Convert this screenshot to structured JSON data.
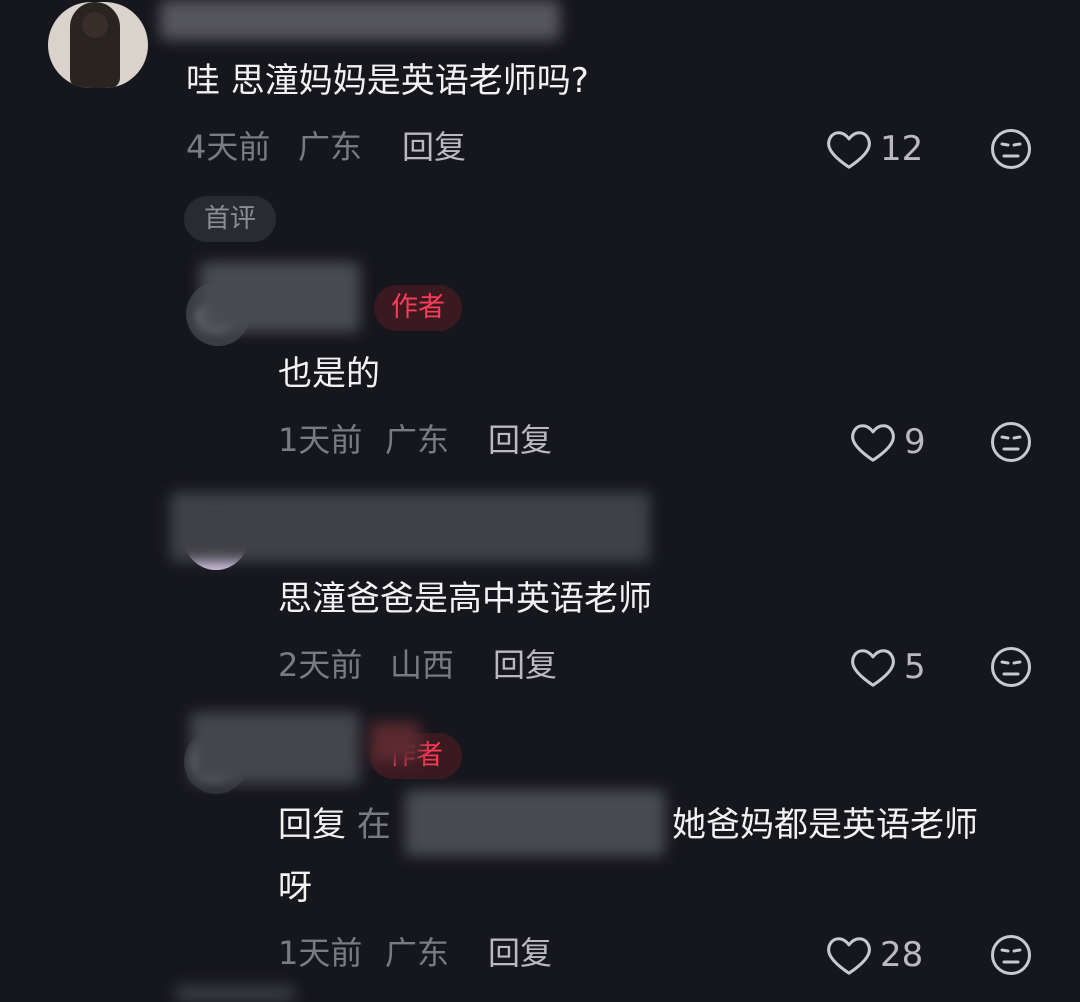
{
  "comments": [
    {
      "text": "哇 思潼妈妈是英语老师吗?",
      "time": "4天前",
      "region": "广东",
      "reply_label": "回复",
      "likes": "12",
      "first_comment_tag": "首评"
    },
    {
      "badge": "作者",
      "text": "也是的",
      "time": "1天前",
      "region": "广东",
      "reply_label": "回复",
      "likes": "9"
    },
    {
      "text": "思潼爸爸是高中英语老师",
      "time": "2天前",
      "region": "山西",
      "reply_label": "回复",
      "likes": "5"
    },
    {
      "badge": "作者",
      "text_prefix": "回复",
      "text_at": "在",
      "text_line1": "她爸妈都是英语老师",
      "text_line2": "呀",
      "time": "1天前",
      "region": "广东",
      "reply_label": "回复",
      "likes": "28"
    }
  ],
  "colors": {
    "background": "#16161d",
    "author_badge_text": "#ff3b56",
    "author_badge_bg": "#3a1a20",
    "meta_text": "#7a7a82",
    "icon": "#c8c8cf"
  },
  "icons": [
    "heart-outline-icon",
    "meh-face-icon"
  ]
}
